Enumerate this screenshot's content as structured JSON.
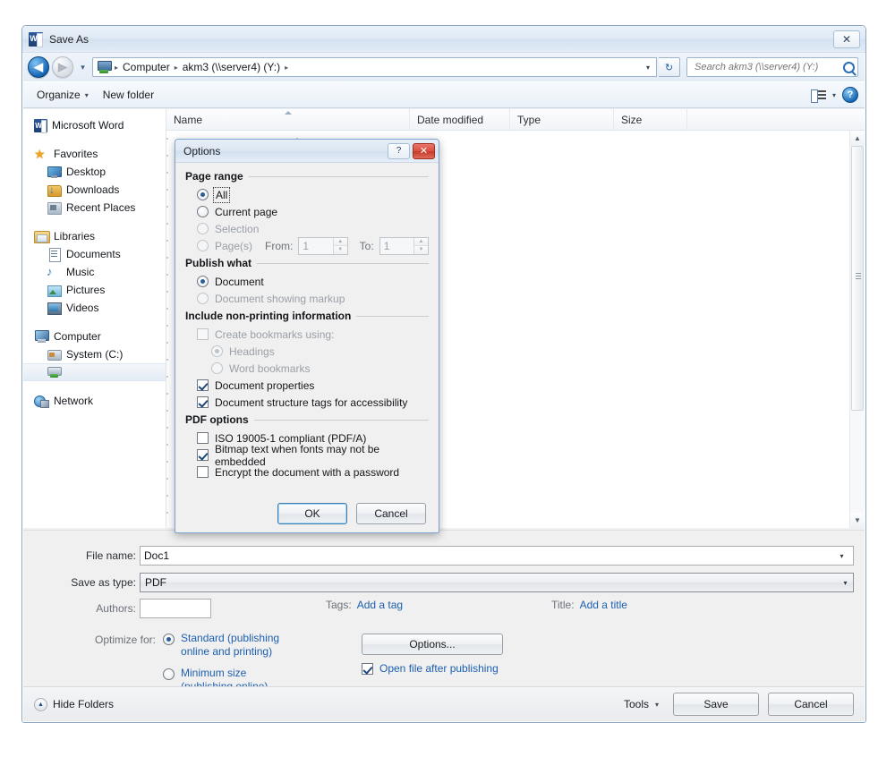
{
  "window": {
    "title": "Save As",
    "app_icon": "word-icon",
    "close_label": "✕"
  },
  "navigation": {
    "back_label": "◀",
    "forward_label": "▶",
    "history_label": "▾",
    "breadcrumb": [
      "Computer",
      "akm3 (\\\\server4) (Y:)"
    ],
    "breadcrumb_sep": "▸",
    "dropdown_label": "▾",
    "refresh_label": "↻",
    "search_placeholder": "Search akm3 (\\\\server4) (Y:)"
  },
  "commandbar": {
    "organize_label": "Organize",
    "organize_caret": "▾",
    "new_folder_label": "New folder",
    "views_caret": "▾",
    "help_label": "?"
  },
  "sidebar": {
    "items": [
      {
        "label": "Microsoft Word",
        "icon": "word-icon",
        "level": 0,
        "selected": false,
        "gap_after": true
      },
      {
        "label": "Favorites",
        "icon": "star-icon",
        "level": 0,
        "selected": false
      },
      {
        "label": "Desktop",
        "icon": "desktop-icon",
        "level": 1,
        "selected": false
      },
      {
        "label": "Downloads",
        "icon": "downloads-icon",
        "level": 1,
        "selected": false
      },
      {
        "label": "Recent Places",
        "icon": "recent-places-icon",
        "level": 1,
        "selected": false,
        "gap_after": true
      },
      {
        "label": "Libraries",
        "icon": "libraries-icon",
        "level": 0,
        "selected": false
      },
      {
        "label": "Documents",
        "icon": "documents-icon",
        "level": 1,
        "selected": false
      },
      {
        "label": "Music",
        "icon": "music-icon",
        "level": 1,
        "selected": false
      },
      {
        "label": "Pictures",
        "icon": "pictures-icon",
        "level": 1,
        "selected": false
      },
      {
        "label": "Videos",
        "icon": "videos-icon",
        "level": 1,
        "selected": false,
        "gap_after": true
      },
      {
        "label": "Computer",
        "icon": "computer-icon",
        "level": 0,
        "selected": false
      },
      {
        "label": "System (C:)",
        "icon": "hard-drive-icon",
        "level": 1,
        "selected": false
      },
      {
        "label": "",
        "icon": "network-drive-icon",
        "level": 1,
        "selected": true,
        "gap_after": true
      },
      {
        "label": "Network",
        "icon": "network-icon",
        "level": 0,
        "selected": false
      }
    ]
  },
  "file_list": {
    "columns": [
      {
        "label": "Name",
        "sorted": true
      },
      {
        "label": "Date modified",
        "sorted": false
      },
      {
        "label": "Type",
        "sorted": false
      },
      {
        "label": "Size",
        "sorted": false
      }
    ],
    "rows": [],
    "scroll_up_label": "▲",
    "scroll_down_label": "▼"
  },
  "form": {
    "file_name_label": "File name:",
    "file_name_value": "Doc1",
    "save_as_type_label": "Save as type:",
    "save_as_type_value": "PDF",
    "save_as_type_arrow": "▾",
    "file_name_arrow": "▾",
    "authors_label": "Authors:",
    "authors_value": "",
    "tags_label": "Tags:",
    "tags_link": "Add a tag",
    "title_label": "Title:",
    "title_link": "Add a title",
    "optimize_label": "Optimize for:",
    "optimize_options": [
      {
        "label": "Standard (publishing online and printing)",
        "selected": true
      },
      {
        "label": "Minimum size (publishing online)",
        "selected": false
      }
    ],
    "options_button": "Options...",
    "open_after_publishing_label": "Open file after publishing",
    "open_after_publishing_checked": true
  },
  "action_bar": {
    "hide_folders_label": "Hide Folders",
    "hide_folders_icon": "▲",
    "tools_label": "Tools",
    "tools_caret": "▾",
    "save_label": "Save",
    "cancel_label": "Cancel"
  },
  "options_dialog": {
    "title": "Options",
    "help_label": "?",
    "close_label": "✕",
    "groups": [
      {
        "title": "Page range",
        "items": [
          {
            "type": "radio",
            "label": "All",
            "accel": "A",
            "checked": true,
            "disabled": false,
            "focused": true
          },
          {
            "type": "radio",
            "label": "Current page",
            "accel": "r",
            "checked": false,
            "disabled": false
          },
          {
            "type": "radio",
            "label": "Selection",
            "accel": "S",
            "checked": false,
            "disabled": true
          },
          {
            "type": "radio-range",
            "label": "Page(s)",
            "accel": "g",
            "checked": false,
            "disabled": true,
            "from_label": "From:",
            "from_value": "1",
            "to_label": "To:",
            "to_value": "1"
          }
        ]
      },
      {
        "title": "Publish what",
        "items": [
          {
            "type": "radio",
            "label": "Document",
            "accel": "D",
            "checked": true,
            "disabled": false
          },
          {
            "type": "radio",
            "label": "Document showing markup",
            "accel": "m",
            "checked": false,
            "disabled": true
          }
        ]
      },
      {
        "title": "Include non-printing information",
        "items": [
          {
            "type": "checkbox",
            "label": "Create bookmarks using:",
            "accel": "C",
            "checked": false,
            "disabled": true
          },
          {
            "type": "radio",
            "label": "Headings",
            "accel": "H",
            "checked": true,
            "disabled": true,
            "indent": true
          },
          {
            "type": "radio",
            "label": "Word bookmarks",
            "accel": "W",
            "checked": false,
            "disabled": true,
            "indent": true
          },
          {
            "type": "checkbox",
            "label": "Document properties",
            "accel": "o",
            "checked": true,
            "disabled": false
          },
          {
            "type": "checkbox",
            "label": "Document structure tags for accessibility",
            "accel": "m",
            "checked": true,
            "disabled": false
          }
        ]
      },
      {
        "title": "PDF options",
        "items": [
          {
            "type": "checkbox",
            "label": "ISO 19005-1 compliant (PDF/A)",
            "accel": "1",
            "checked": false,
            "disabled": false
          },
          {
            "type": "checkbox",
            "label": "Bitmap text when fonts may not be embedded",
            "accel": "x",
            "checked": true,
            "disabled": false
          },
          {
            "type": "checkbox",
            "label": "Encrypt the document with a password",
            "accel": "E",
            "checked": false,
            "disabled": false
          }
        ]
      }
    ],
    "ok_label": "OK",
    "cancel_label": "Cancel"
  },
  "colors": {
    "accent_blue": "#2b5d95",
    "link_blue": "#1c5fb0",
    "close_red": "#c43a28",
    "window_border": "#8ca7c4",
    "dialog_border": "#7ba3cc"
  }
}
